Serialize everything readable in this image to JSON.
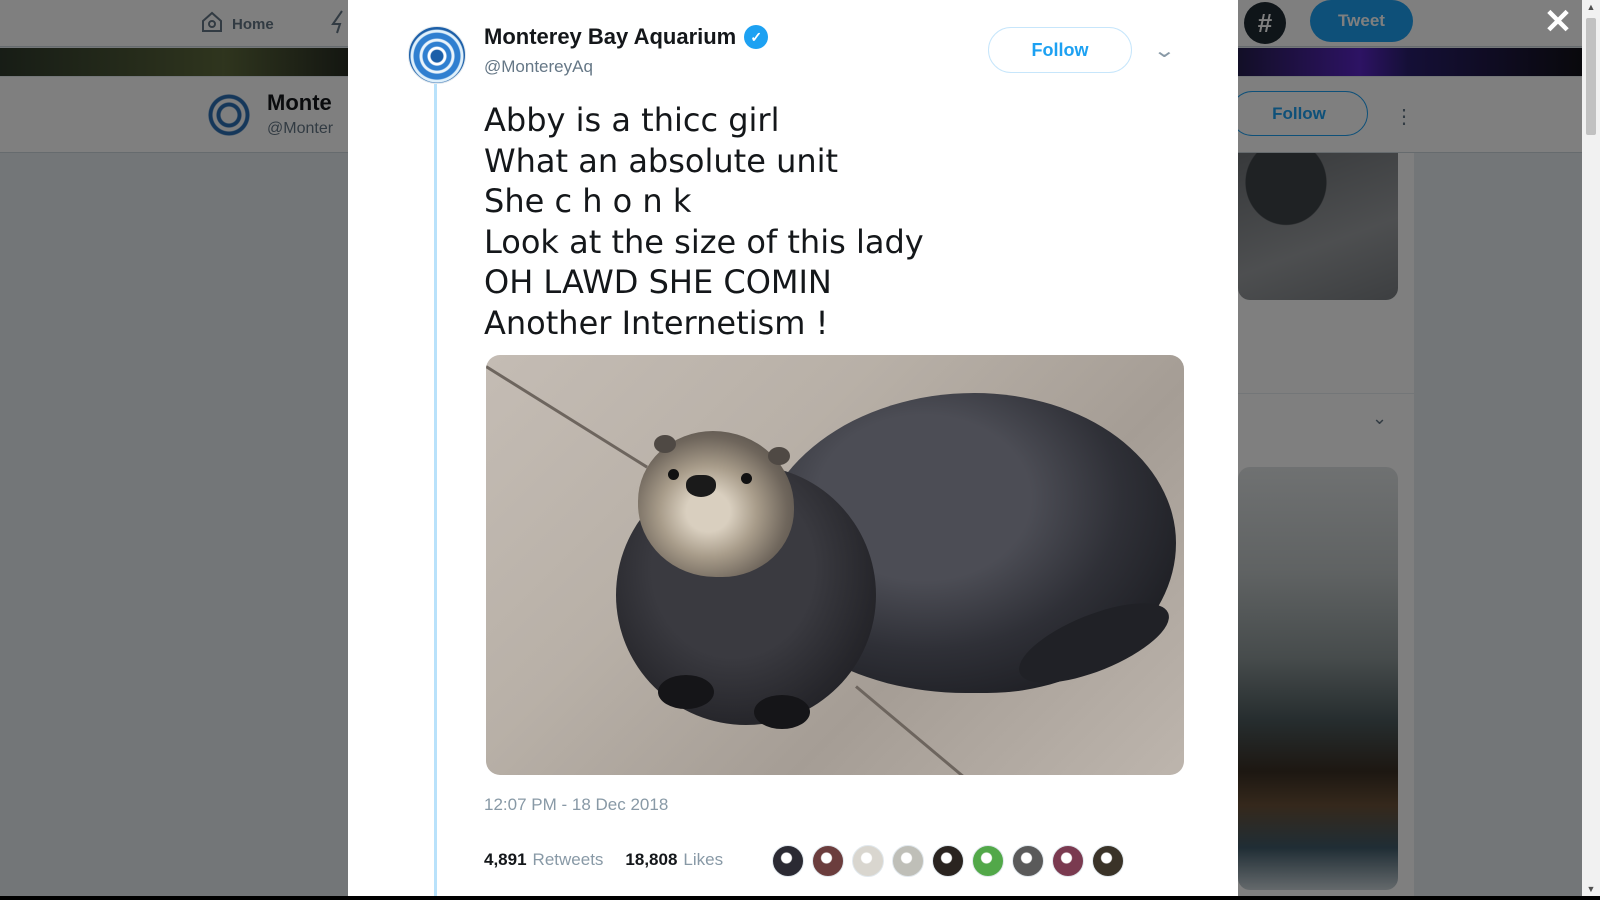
{
  "background_page": {
    "nav": {
      "home_label": "Home",
      "tweet_button": "Tweet"
    },
    "profile": {
      "name_partial": "Monte",
      "handle_partial": "@Monter"
    },
    "follow_button": "Follow"
  },
  "tweet": {
    "display_name": "Monterey Bay Aquarium",
    "verified": true,
    "handle": "@MontereyAq",
    "follow_button": "Follow",
    "text_lines": [
      "Abby is a thicc girl",
      "What an absolute unit",
      "She c h o n k",
      "Look at the size of this lady",
      "OH LAWD SHE COMIN",
      "Another Internetism !"
    ],
    "photo_subject": "sea otter on rock",
    "timestamp": "12:07 PM - 18 Dec 2018",
    "retweets": {
      "count": "4,891",
      "label": "Retweets"
    },
    "likes": {
      "count": "18,808",
      "label": "Likes"
    },
    "liker_avatar_colors": [
      "#2b2a33",
      "#6b3d3d",
      "#d9d6cf",
      "#bfbfb8",
      "#2a2420",
      "#52a849",
      "#5a5a5a",
      "#7a3a50",
      "#3a3328"
    ]
  },
  "colors": {
    "accent": "#1da1f2",
    "text_primary": "#14171a",
    "text_secondary": "#657786",
    "thread_line": "#b9e2fb"
  },
  "icons": {
    "close": "close-icon",
    "verified": "verified-badge-icon",
    "caret": "chevron-down-icon",
    "home": "home-icon",
    "hashtag": "hashtag-icon"
  }
}
